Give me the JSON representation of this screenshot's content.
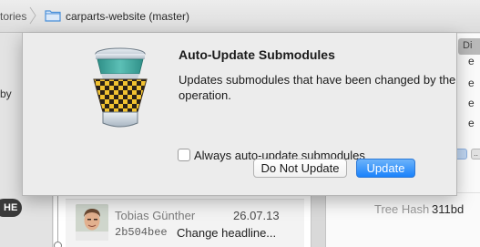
{
  "breadcrumb": {
    "previous": "tories",
    "current": "carparts-website (master)"
  },
  "left_pane": {
    "partial_text": "by",
    "head_badge": "HE"
  },
  "commit": {
    "author": "Tobias Günther",
    "date": "26.07.13",
    "hash": "2b504bee",
    "message": "Change headline..."
  },
  "right_pane": {
    "tab_label": "Di",
    "edge_texts": [
      "e",
      "e",
      "e",
      "e"
    ],
    "pill_label": "..",
    "tree_hash_label": "Tree Hash",
    "tree_hash_value": "311bd"
  },
  "dialog": {
    "title": "Auto-Update Submodules",
    "message": "Updates submodules that have been changed by the operation.",
    "checkbox_label": "Always auto-update submodules",
    "checkbox_checked": false,
    "secondary_button": "Do Not Update",
    "primary_button": "Update",
    "icon": "tower-app-icon"
  },
  "colors": {
    "primary_button": "#1a82fb",
    "sheet_background": "#ececec",
    "folder_icon": "#4a90d9"
  }
}
